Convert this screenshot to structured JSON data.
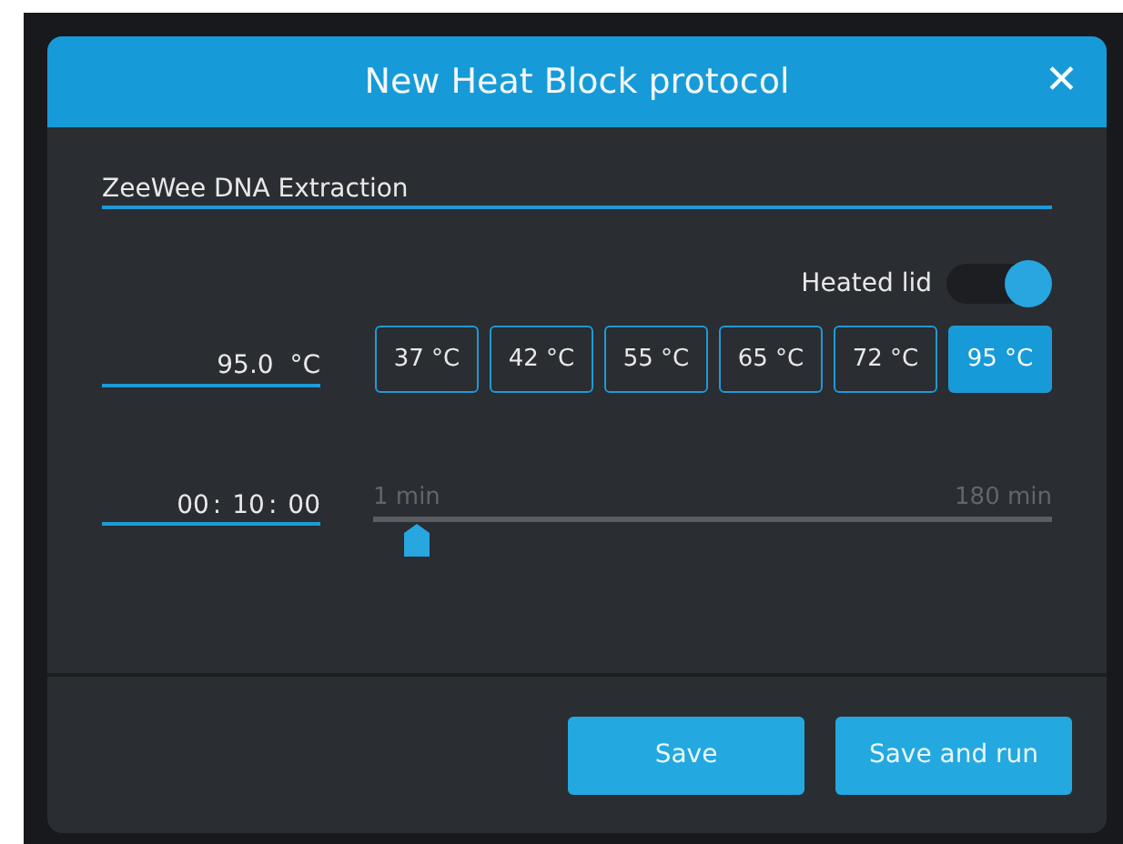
{
  "dialog": {
    "title": "New Heat Block protocol",
    "close": "✕"
  },
  "name_field": {
    "value": "ZeeWee DNA Extraction"
  },
  "heated_lid": {
    "label": "Heated lid",
    "on": true
  },
  "temperature": {
    "value": "95.0",
    "unit": "°C",
    "presets": [
      {
        "label": "37 °C",
        "selected": false
      },
      {
        "label": "42 °C",
        "selected": false
      },
      {
        "label": "55 °C",
        "selected": false
      },
      {
        "label": "65 °C",
        "selected": false
      },
      {
        "label": "72 °C",
        "selected": false
      },
      {
        "label": "95 °C",
        "selected": true
      }
    ]
  },
  "time": {
    "hours": "00",
    "minutes": "10",
    "seconds": "00",
    "separator": ":",
    "min_label": "1 min",
    "max_label": "180 min",
    "level": 0.065
  },
  "buttons": [
    "Save",
    "Save and run"
  ]
}
